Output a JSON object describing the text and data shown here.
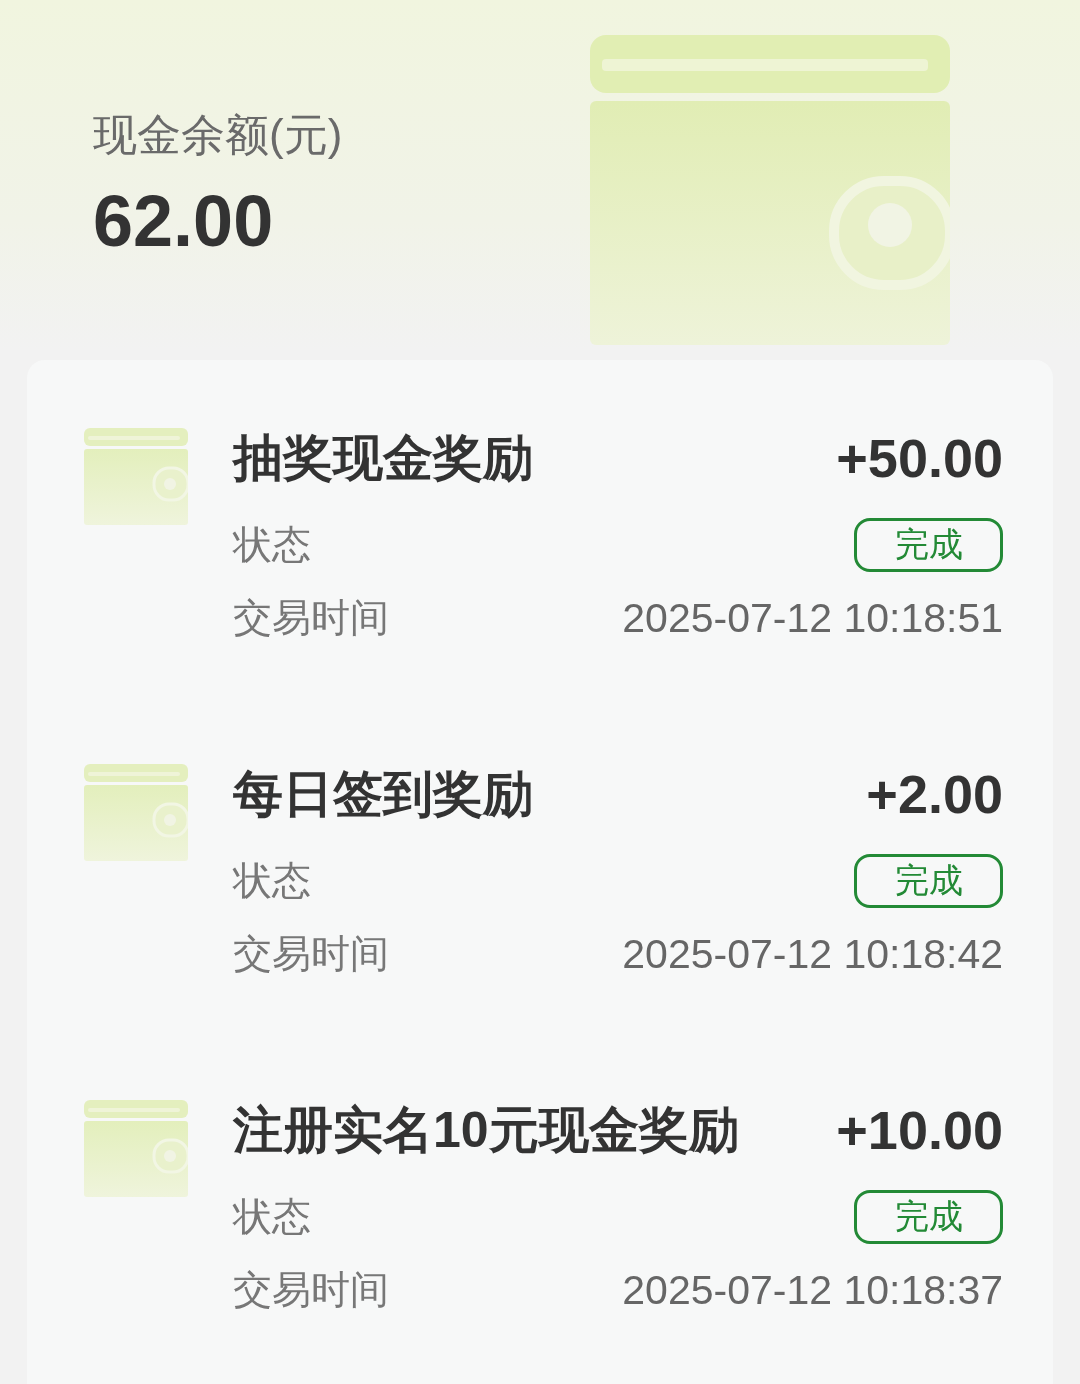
{
  "header": {
    "label": "现金余额(元)",
    "amount": "62.00"
  },
  "transactions": [
    {
      "title": "抽奖现金奖励",
      "amount": "+50.00",
      "status_label": "状态",
      "status": "完成",
      "time_label": "交易时间",
      "time": "2025-07-12 10:18:51"
    },
    {
      "title": "每日签到奖励",
      "amount": "+2.00",
      "status_label": "状态",
      "status": "完成",
      "time_label": "交易时间",
      "time": "2025-07-12 10:18:42"
    },
    {
      "title": "注册实名10元现金奖励",
      "amount": "+10.00",
      "status_label": "状态",
      "status": "完成",
      "time_label": "交易时间",
      "time": "2025-07-12 10:18:37"
    }
  ]
}
